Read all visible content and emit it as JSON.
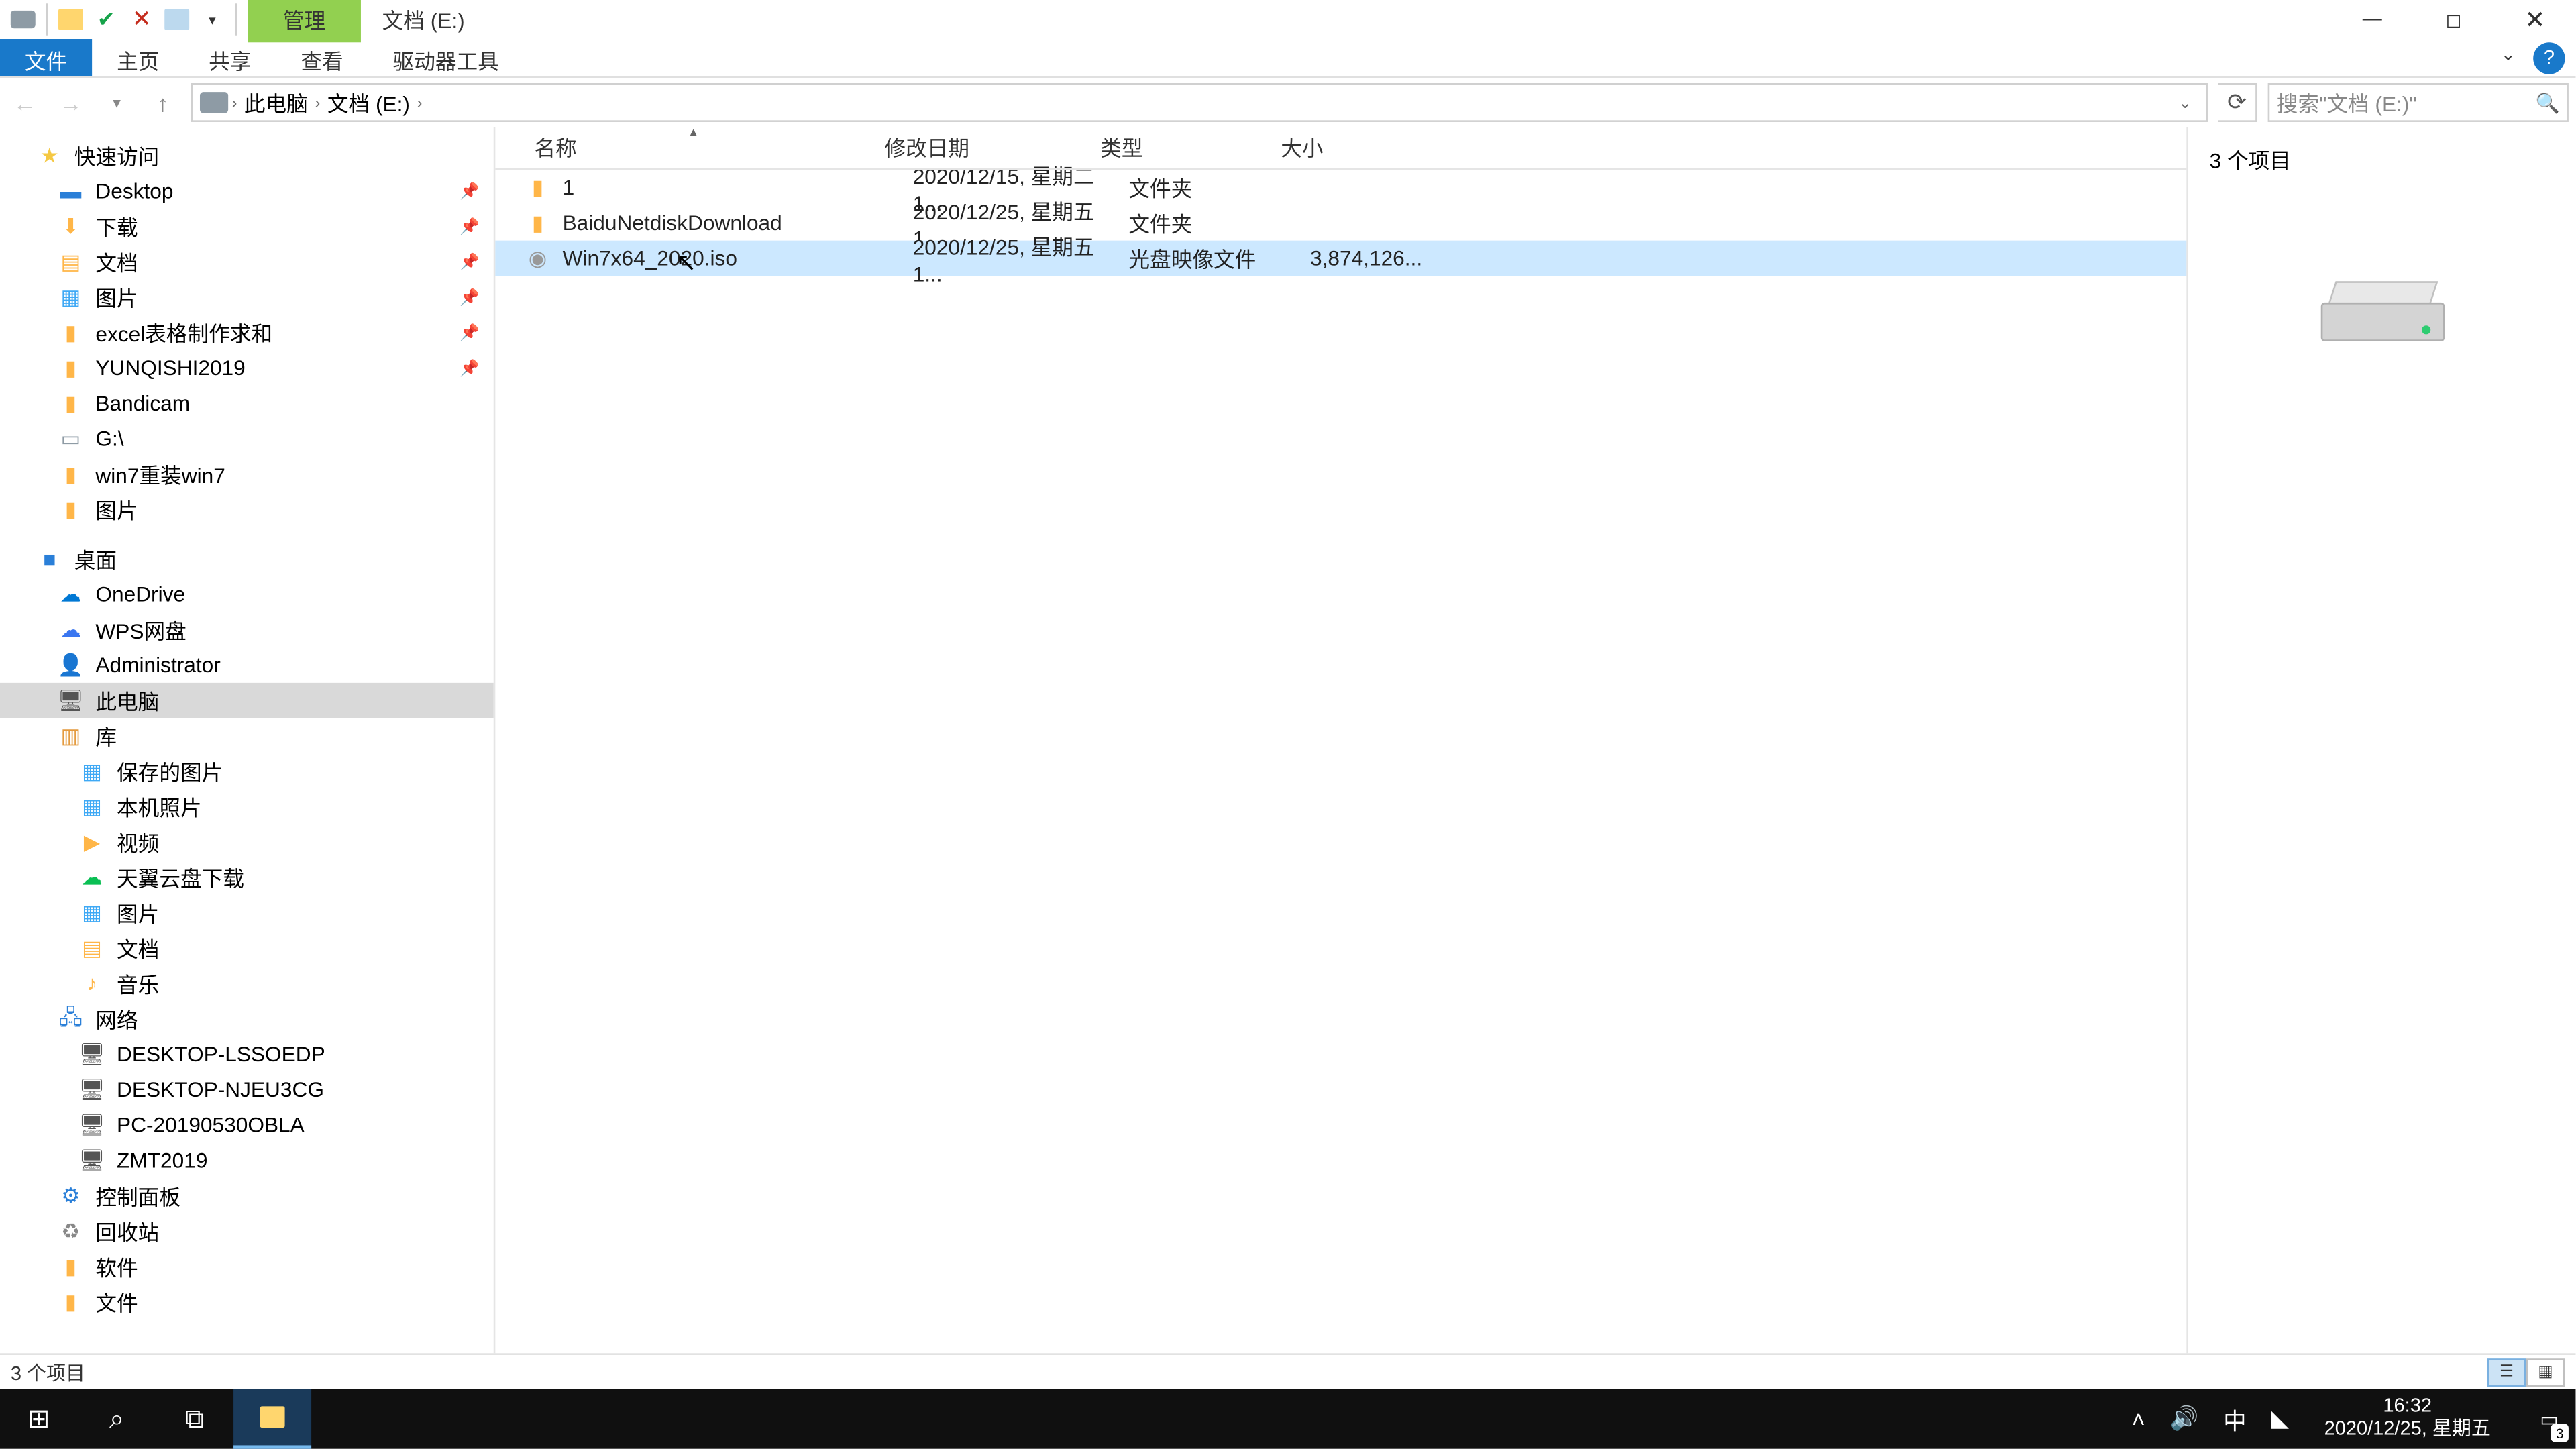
{
  "title_tab_manage": "管理",
  "title_tab_docs": "文档 (E:)",
  "ribbon": {
    "file": "文件",
    "home": "主页",
    "share": "共享",
    "view": "查看",
    "drive": "驱动器工具"
  },
  "breadcrumb": {
    "pc": "此电脑",
    "loc": "文档 (E:)"
  },
  "search_placeholder": "搜索\"文档 (E:)\"",
  "nav": {
    "quick": "快速访问",
    "pinned": [
      "Desktop",
      "下载",
      "文档",
      "图片",
      "excel表格制作求和",
      "YUNQISHI2019"
    ],
    "bandicam": "Bandicam",
    "gdrive": "G:\\",
    "win7": "win7重装win7",
    "pic2": "图片",
    "desktop": "桌面",
    "onedrive": "OneDrive",
    "wps": "WPS网盘",
    "admin": "Administrator",
    "thispc": "此电脑",
    "lib": "库",
    "lib_items": [
      "保存的图片",
      "本机照片",
      "视频",
      "天翼云盘下载",
      "图片",
      "文档",
      "音乐"
    ],
    "network": "网络",
    "net_items": [
      "DESKTOP-LSSOEDP",
      "DESKTOP-NJEU3CG",
      "PC-20190530OBLA",
      "ZMT2019"
    ],
    "panel": "控制面板",
    "recycle": "回收站",
    "soft": "软件",
    "docs": "文件"
  },
  "cols": {
    "name": "名称",
    "date": "修改日期",
    "type": "类型",
    "size": "大小"
  },
  "rows": [
    {
      "name": "1",
      "date": "2020/12/15, 星期二 1...",
      "type": "文件夹",
      "size": ""
    },
    {
      "name": "BaiduNetdiskDownload",
      "date": "2020/12/25, 星期五 1...",
      "type": "文件夹",
      "size": ""
    },
    {
      "name": "Win7x64_2020.iso",
      "date": "2020/12/25, 星期五 1...",
      "type": "光盘映像文件",
      "size": "3,874,126..."
    }
  ],
  "preview_count": "3 个项目",
  "status_text": "3 个项目",
  "clock": {
    "time": "16:32",
    "date": "2020/12/25, 星期五"
  },
  "ime": "中",
  "notif_count": "3"
}
